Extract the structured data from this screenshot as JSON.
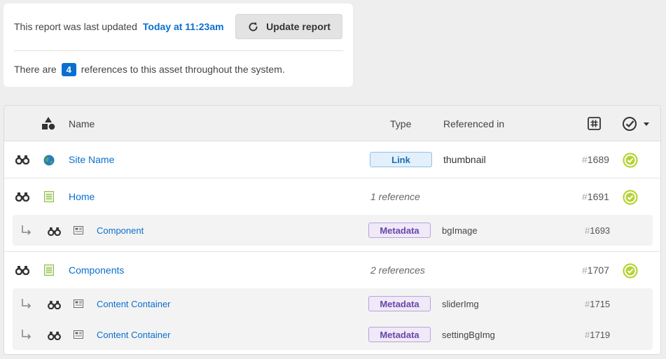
{
  "report": {
    "last_updated_label": "This report was last updated",
    "last_updated_value": "Today at 11:23am",
    "update_button_label": "Update report",
    "references_prefix": "There are",
    "references_count": "4",
    "references_suffix": "references to this asset throughout the system."
  },
  "table": {
    "headers": {
      "name": "Name",
      "type": "Type",
      "referenced_in": "Referenced in"
    },
    "rows": [
      {
        "name": "Site Name",
        "type_badge": "Link",
        "referenced_in": "thumbnail",
        "id_hash": "#",
        "id": "1689",
        "icon": "globe-icon",
        "status": "check-circle-icon"
      },
      {
        "name": "Home",
        "type_text": "1 reference",
        "id_hash": "#",
        "id": "1691",
        "icon": "page-icon",
        "status": "check-circle-icon",
        "children": [
          {
            "name": "Component",
            "type_badge": "Metadata",
            "referenced_in": "bgImage",
            "id_hash": "#",
            "id": "1693"
          }
        ]
      },
      {
        "name": "Components",
        "type_text": "2 references",
        "id_hash": "#",
        "id": "1707",
        "icon": "page-icon",
        "status": "check-circle-icon",
        "children": [
          {
            "name": "Content Container",
            "type_badge": "Metadata",
            "referenced_in": "sliderImg",
            "id_hash": "#",
            "id": "1715"
          },
          {
            "name": "Content Container",
            "type_badge": "Metadata",
            "referenced_in": "settingBgImg",
            "id_hash": "#",
            "id": "1719"
          }
        ]
      }
    ]
  },
  "colors": {
    "accent": "#0a6fd0",
    "status_green": "#b5d334",
    "link_badge_bg": "#e3f0fb",
    "metadata_badge_bg": "#efe9f8"
  }
}
